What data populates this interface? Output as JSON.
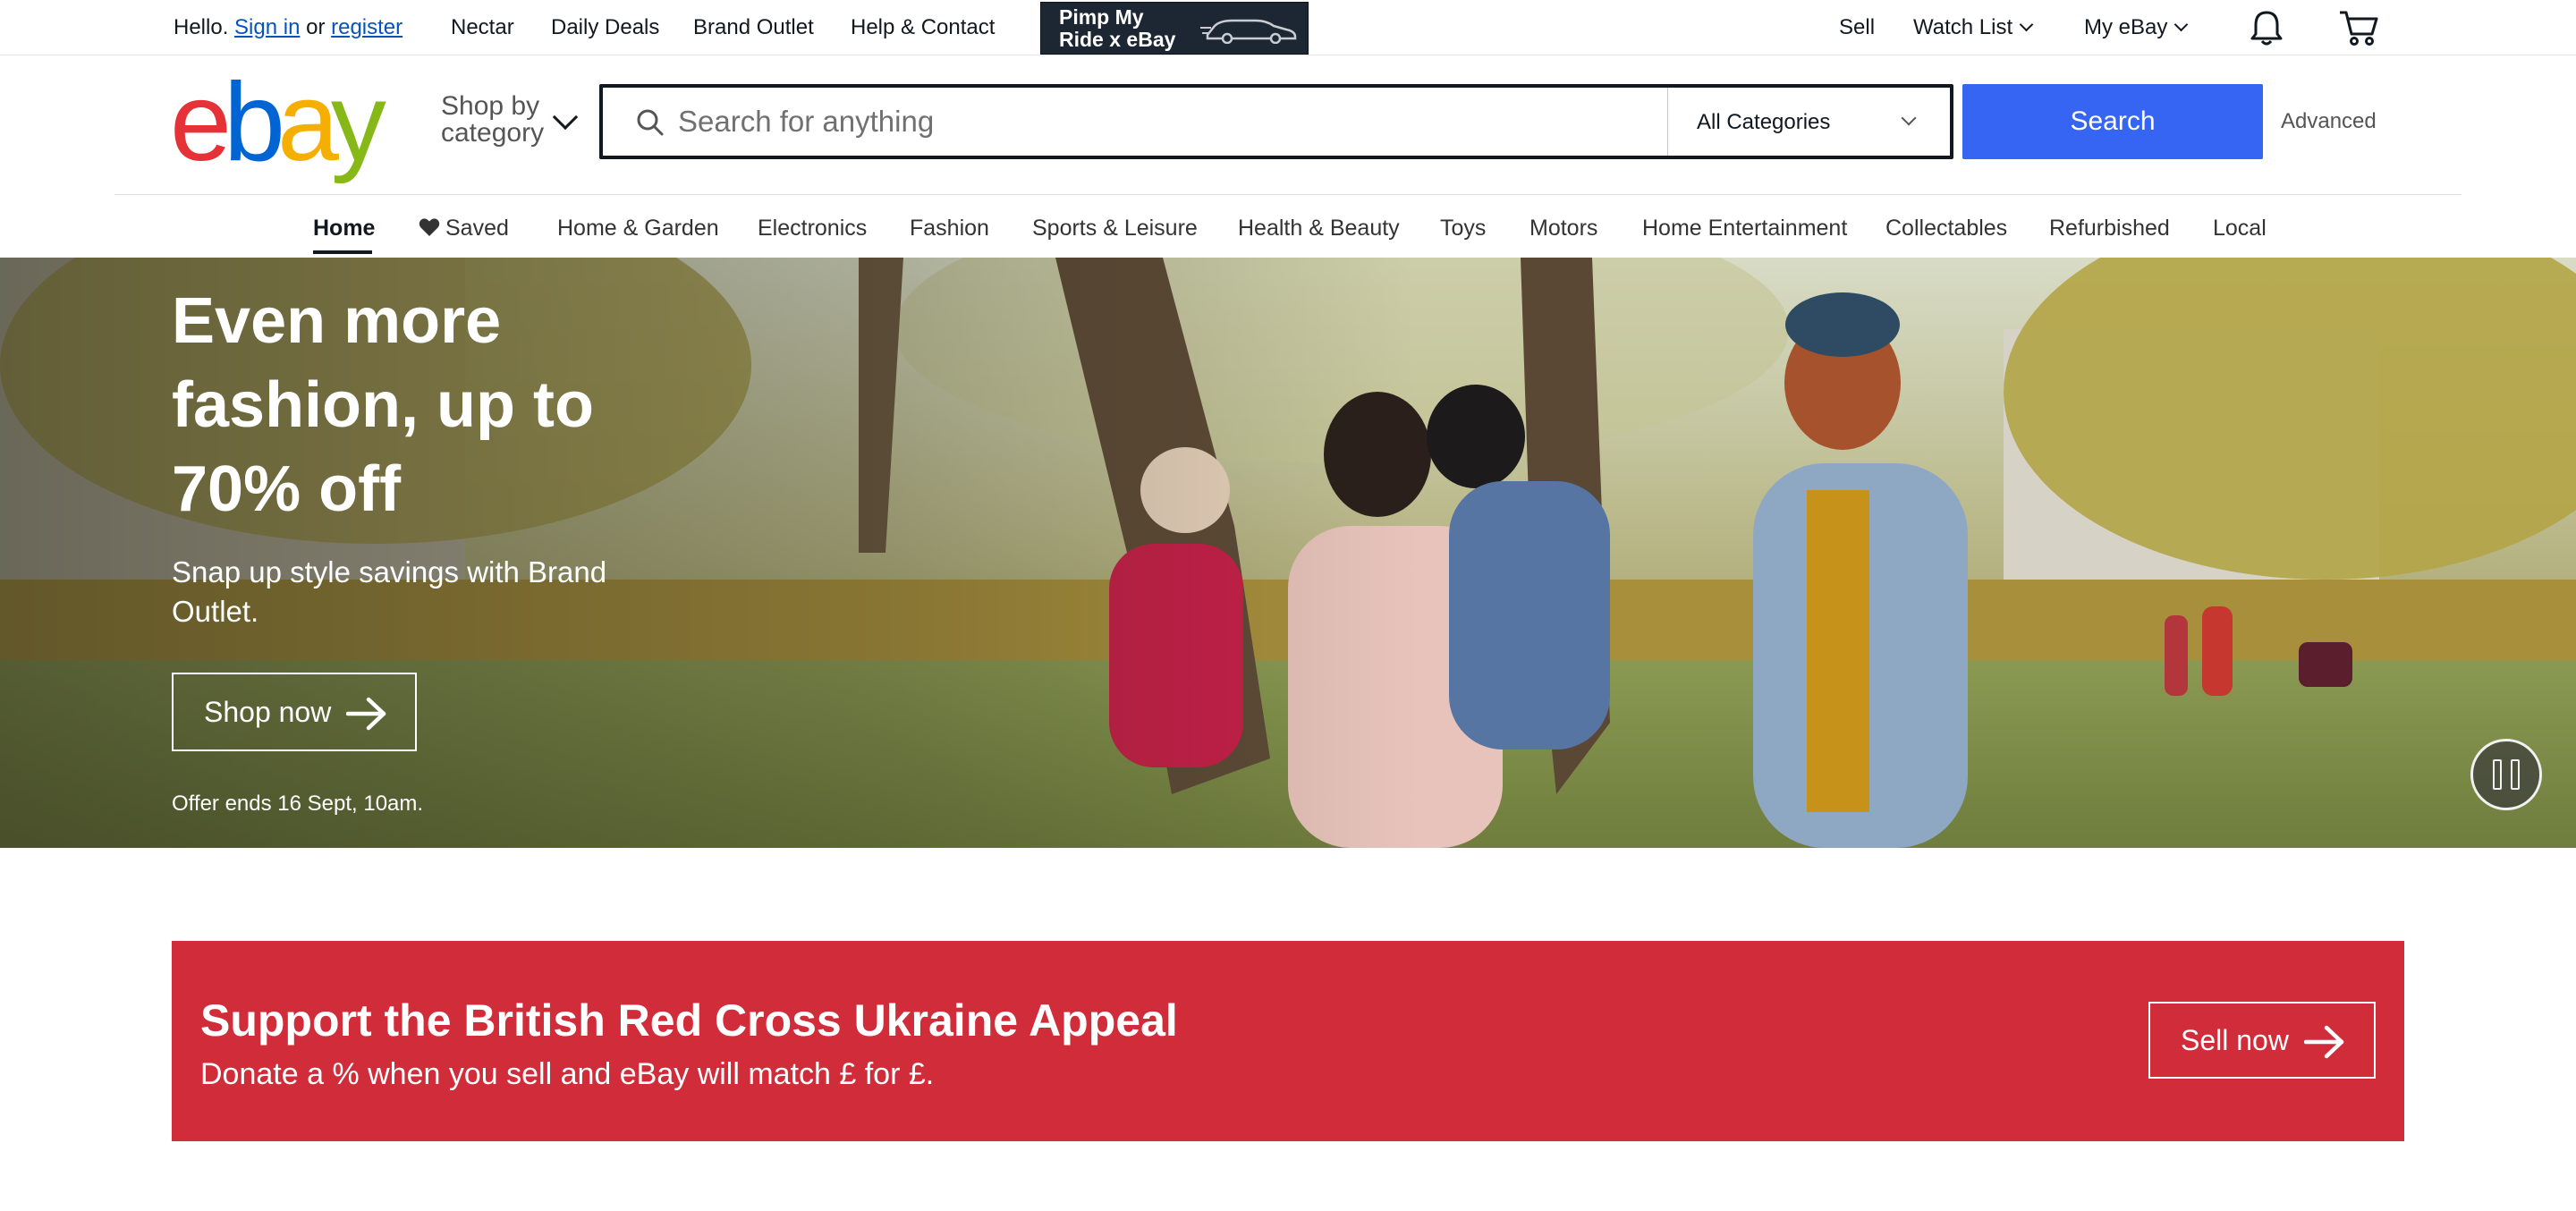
{
  "topbar": {
    "greeting": "Hello.",
    "sign_in": "Sign in",
    "or": "or",
    "register": "register",
    "links": [
      "Nectar",
      "Daily Deals",
      "Brand Outlet",
      "Help & Contact"
    ],
    "promo_banner": "Pimp My Ride x eBay",
    "sell": "Sell",
    "watch_list": "Watch List",
    "my_ebay": "My eBay",
    "icons": [
      "bell-icon",
      "cart-icon"
    ]
  },
  "header": {
    "logo_letters": [
      "e",
      "b",
      "a",
      "y"
    ],
    "logo_colors": [
      "#e53238",
      "#0064d2",
      "#f5af02",
      "#86b817"
    ],
    "shop_by_line1": "Shop by",
    "shop_by_line2": "category",
    "search_placeholder": "Search for anything",
    "search_value": "",
    "category_selected": "All Categories",
    "search_button": "Search",
    "advanced": "Advanced",
    "search_button_color": "#3665f3"
  },
  "nav": {
    "items": [
      "Home",
      "Saved",
      "Home & Garden",
      "Electronics",
      "Fashion",
      "Sports & Leisure",
      "Health & Beauty",
      "Toys",
      "Motors",
      "Home Entertainment",
      "Collectables",
      "Refurbished",
      "Local"
    ],
    "active": "Home"
  },
  "hero": {
    "title": "Even more fashion, up to 70% off",
    "subtitle": "Snap up style savings with Brand Outlet.",
    "button": "Shop now",
    "offer": "Offer ends 16 Sept, 10am.",
    "pause_icon": "pause-icon"
  },
  "appeal": {
    "title": "Support the British Red Cross Ukraine Appeal",
    "subtitle": "Donate a % when you sell and eBay will match £ for £.",
    "button": "Sell now",
    "background_color": "#d02c3a"
  }
}
